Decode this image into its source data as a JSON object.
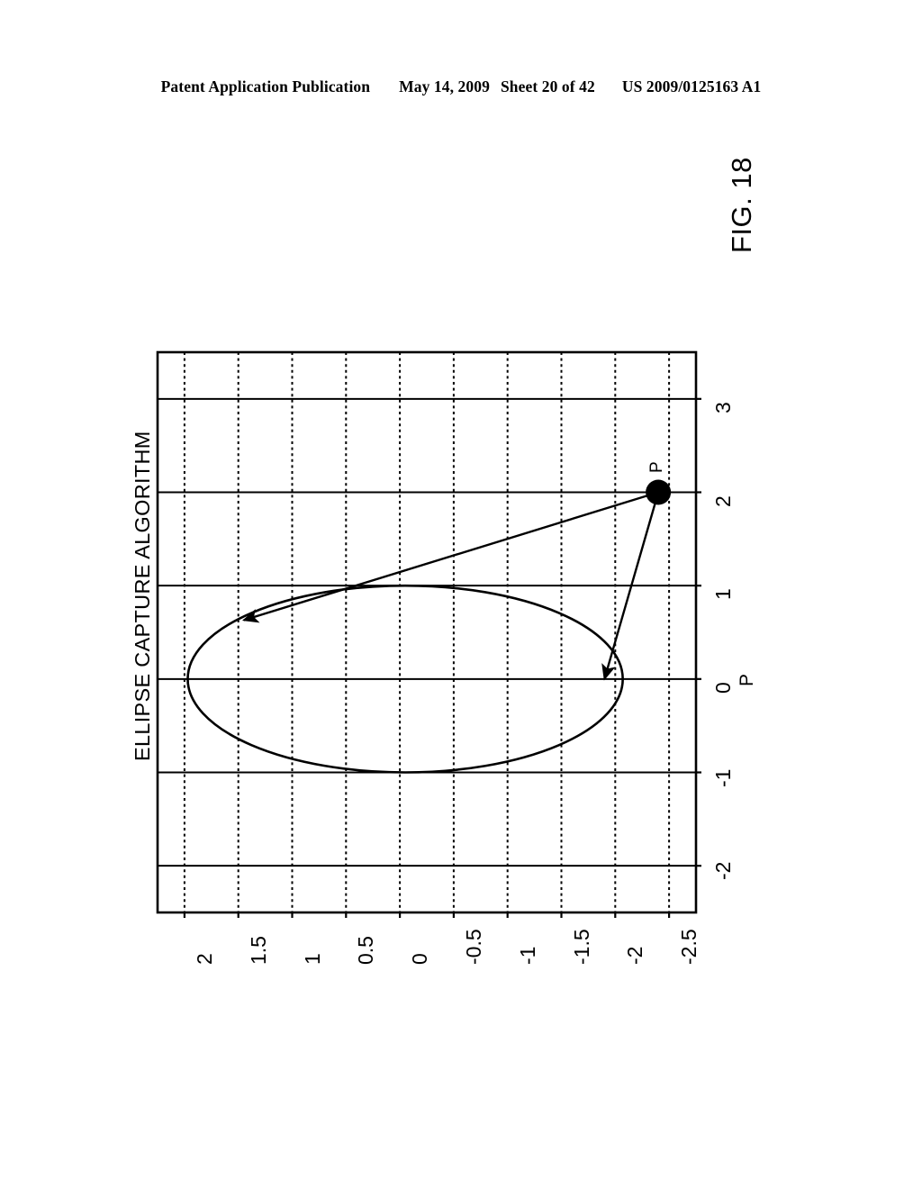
{
  "header": {
    "publication": "Patent Application Publication",
    "date": "May 14, 2009",
    "sheet": "Sheet 20 of 42",
    "patent_number": "US 2009/0125163 A1"
  },
  "figure": {
    "label": "FIG. 18"
  },
  "chart_data": {
    "type": "line",
    "title": "ELLIPSE CAPTURE ALGORITHM",
    "orientation": "rotated-90-ccw",
    "xlabel": "P",
    "ylabel": "P",
    "xlim": [
      -2.5,
      3.5
    ],
    "ylim": [
      -2.75,
      2.25
    ],
    "xticks": [
      -2,
      -1,
      0,
      1,
      2,
      3
    ],
    "xticklabels": [
      "-2",
      "-1",
      "0",
      "1",
      "2",
      "3"
    ],
    "yticks": [
      2,
      1.5,
      1,
      0.5,
      0,
      -0.5,
      -1,
      -1.5,
      -2,
      -2.5
    ],
    "yticklabels": [
      "2",
      "1.5",
      "1",
      "0.5",
      "0",
      "-0.5",
      "-1",
      "-1.5",
      "-2",
      "-2.5"
    ],
    "grid": "major-solid-horizontal, minor-dotted-vertical",
    "legend": "none",
    "annotations": [
      {
        "text": "P",
        "x": 2.0,
        "y": -2.4,
        "kind": "point-marker-label"
      }
    ],
    "series": [
      {
        "name": "ellipse",
        "kind": "ellipse",
        "center_x": 0.0,
        "center_y": -0.05,
        "semi_axis_x": 1.0,
        "semi_axis_y": 2.02
      },
      {
        "name": "capture-trajectory-inbound",
        "kind": "arrow",
        "from_x": 2.0,
        "from_y": -2.4,
        "to_x": 0.0,
        "to_y": -1.9
      },
      {
        "name": "capture-trajectory-outbound",
        "kind": "arrow",
        "from_x": 2.0,
        "from_y": -2.4,
        "to_x": 0.63,
        "to_y": 1.45
      }
    ],
    "points": [
      {
        "name": "P",
        "x": 2.0,
        "y": -2.4,
        "marker": "filled-circle"
      }
    ]
  }
}
